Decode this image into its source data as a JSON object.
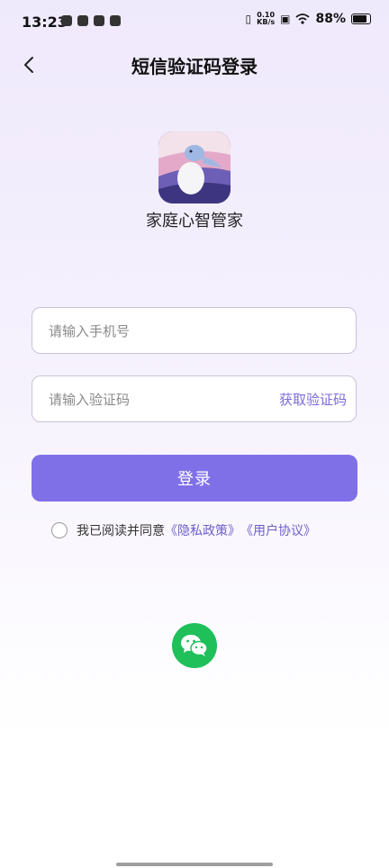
{
  "status_bar": {
    "time": "13:23",
    "net_speed_value": "0.10",
    "net_speed_unit": "KB/s",
    "battery": "88%"
  },
  "header": {
    "title": "短信验证码登录",
    "back_icon": "chevron-left-icon"
  },
  "app": {
    "name": "家庭心智管家"
  },
  "phone_field": {
    "placeholder": "请输入手机号",
    "value": ""
  },
  "code_field": {
    "placeholder": "请输入验证码",
    "value": "",
    "get_code_label": "获取验证码"
  },
  "login_button": {
    "label": "登录"
  },
  "agreement": {
    "prefix": "我已阅读并同意",
    "privacy_link": "《隐私政策》",
    "terms_link": "《用户协议》",
    "checked": false
  },
  "wechat_login": {
    "icon": "wechat-icon"
  },
  "colors": {
    "accent": "#8070e8",
    "link": "#6d5fc8",
    "wechat": "#1fbf5a"
  }
}
